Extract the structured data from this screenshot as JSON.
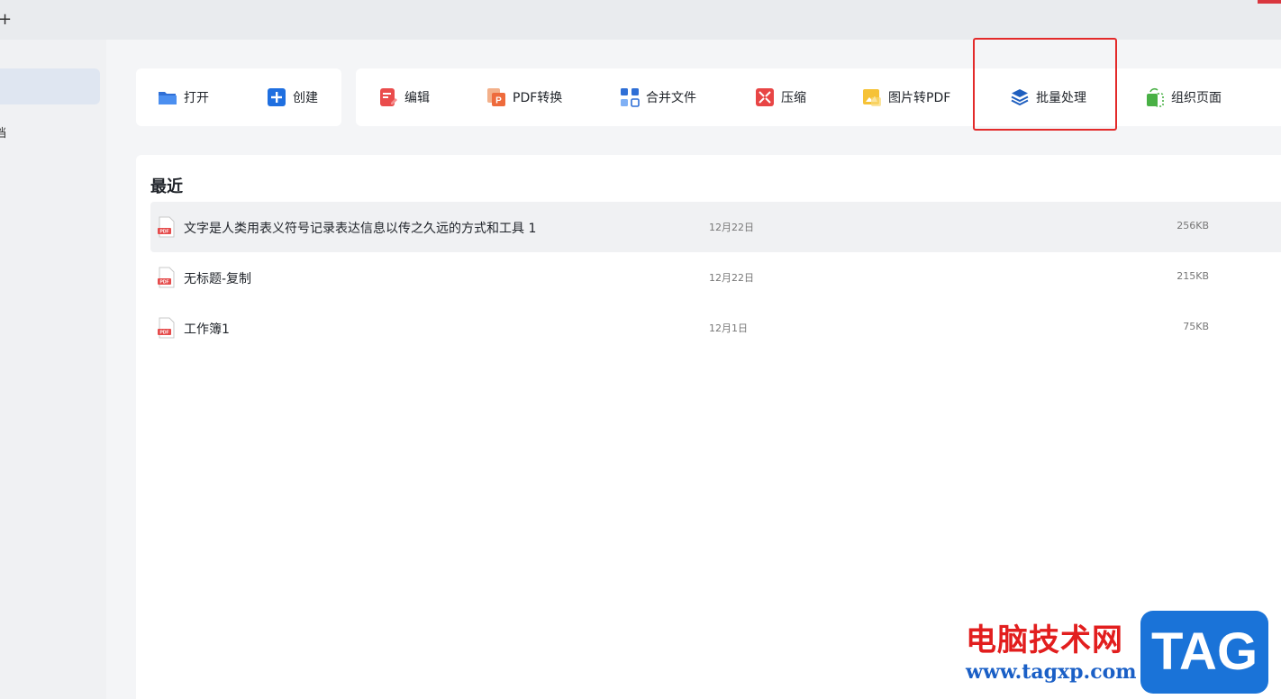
{
  "titlebar": {
    "new_tab_label": "+"
  },
  "sidebar": {
    "item_fragment": "档"
  },
  "toolbar": {
    "open_label": "打开",
    "create_label": "创建",
    "edit_label": "编辑",
    "pdf_convert_label": "PDF转换",
    "merge_label": "合并文件",
    "compress_label": "压缩",
    "image_to_pdf_label": "图片转PDF",
    "batch_label": "批量处理",
    "organize_label": "组织页面"
  },
  "recent": {
    "title": "最近",
    "files": [
      {
        "name": "文字是人类用表义符号记录表达信息以传之久远的方式和工具 1",
        "date": "12月22日",
        "size": "256KB"
      },
      {
        "name": "无标题-复制",
        "date": "12月22日",
        "size": "215KB"
      },
      {
        "name": "工作簿1",
        "date": "12月1日",
        "size": "75KB"
      }
    ]
  },
  "watermark": {
    "site_name": "电脑技术网",
    "url": "www.tagxp.com",
    "badge": "TAG"
  },
  "colors": {
    "accent_blue": "#1a73d8",
    "highlight_red": "#e32a2a",
    "pdf_red": "#e54b4b"
  }
}
